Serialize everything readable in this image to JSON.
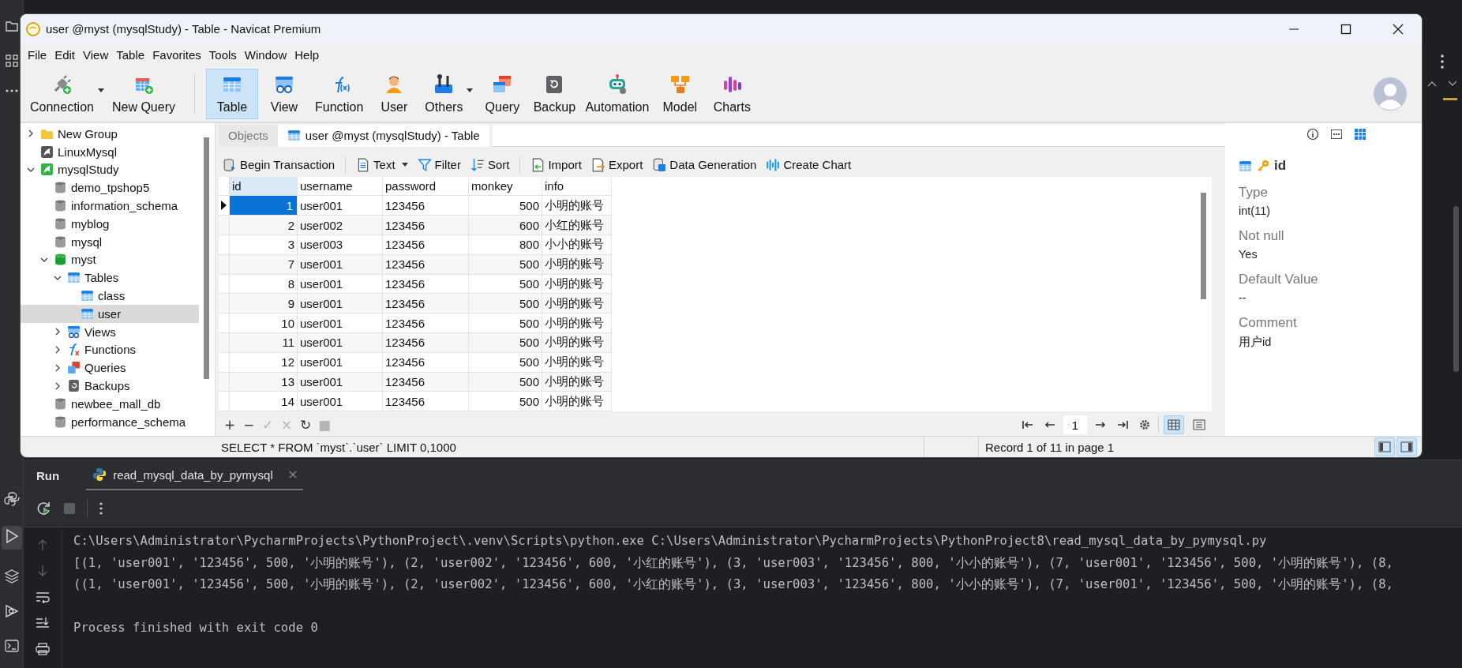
{
  "window": {
    "title": "user @myst (mysqlStudy) - Table - Navicat Premium",
    "menu": [
      "File",
      "Edit",
      "View",
      "Table",
      "Favorites",
      "Tools",
      "Window",
      "Help"
    ],
    "toolbar": [
      {
        "label": "Connection",
        "dropdown": true,
        "selected": false
      },
      {
        "label": "New Query",
        "dropdown": false,
        "selected": false
      },
      {
        "label": "Table",
        "dropdown": false,
        "selected": true
      },
      {
        "label": "View",
        "dropdown": false,
        "selected": false
      },
      {
        "label": "Function",
        "dropdown": false,
        "selected": false
      },
      {
        "label": "User",
        "dropdown": false,
        "selected": false
      },
      {
        "label": "Others",
        "dropdown": true,
        "selected": false
      },
      {
        "label": "Query",
        "dropdown": false,
        "selected": false
      },
      {
        "label": "Backup",
        "dropdown": false,
        "selected": false
      },
      {
        "label": "Automation",
        "dropdown": false,
        "selected": false
      },
      {
        "label": "Model",
        "dropdown": false,
        "selected": false
      },
      {
        "label": "Charts",
        "dropdown": false,
        "selected": false
      }
    ],
    "sidebar": {
      "items": [
        {
          "label": "New Group",
          "kind": "group",
          "expanded": false,
          "selected": false
        },
        {
          "label": "LinuxMysql",
          "kind": "connection",
          "open": false,
          "selected": false
        },
        {
          "label": "mysqlStudy",
          "kind": "connection",
          "expanded": true,
          "open": true,
          "selected": false,
          "children": [
            {
              "label": "demo_tpshop5",
              "kind": "database",
              "open": false,
              "selected": false
            },
            {
              "label": "information_schema",
              "kind": "database",
              "open": false,
              "selected": false
            },
            {
              "label": "myblog",
              "kind": "database",
              "open": false,
              "selected": false
            },
            {
              "label": "mysql",
              "kind": "database",
              "open": false,
              "selected": false
            },
            {
              "label": "myst",
              "kind": "database",
              "expanded": true,
              "open": true,
              "selected": false,
              "children": [
                {
                  "label": "Tables",
                  "kind": "tables",
                  "expanded": true,
                  "selected": false,
                  "children": [
                    {
                      "label": "class",
                      "kind": "table",
                      "selected": false
                    },
                    {
                      "label": "user",
                      "kind": "table",
                      "selected": true
                    }
                  ]
                },
                {
                  "label": "Views",
                  "kind": "views",
                  "expanded": false,
                  "selected": false
                },
                {
                  "label": "Functions",
                  "kind": "functions",
                  "expanded": false,
                  "selected": false
                },
                {
                  "label": "Queries",
                  "kind": "queries",
                  "expanded": false,
                  "selected": false
                },
                {
                  "label": "Backups",
                  "kind": "backups",
                  "expanded": false,
                  "selected": false
                }
              ]
            },
            {
              "label": "newbee_mall_db",
              "kind": "database",
              "open": false,
              "selected": false
            },
            {
              "label": "performance_schema",
              "kind": "database",
              "open": false,
              "selected": false
            }
          ]
        }
      ]
    },
    "tabs": [
      {
        "label": "Objects",
        "selected": false
      },
      {
        "label": "user @myst (mysqlStudy) - Table",
        "selected": true
      }
    ],
    "actions": [
      {
        "label": "Begin Transaction",
        "dropdown": false
      },
      {
        "label": "Text",
        "dropdown": true
      },
      {
        "label": "Filter",
        "dropdown": false
      },
      {
        "label": "Sort",
        "dropdown": false
      },
      {
        "label": "Import",
        "dropdown": false
      },
      {
        "label": "Export",
        "dropdown": false
      },
      {
        "label": "Data Generation",
        "dropdown": false
      },
      {
        "label": "Create Chart",
        "dropdown": false
      }
    ],
    "grid": {
      "columns": [
        {
          "label": "id",
          "selected": true
        },
        {
          "label": "username",
          "selected": false
        },
        {
          "label": "password",
          "selected": false
        },
        {
          "label": "monkey",
          "selected": false
        },
        {
          "label": "info",
          "selected": false
        }
      ],
      "rows": [
        {
          "cells": [
            "1",
            "user001",
            "123456",
            "500",
            "小明的账号"
          ],
          "selected": true
        },
        {
          "cells": [
            "2",
            "user002",
            "123456",
            "600",
            "小红的账号"
          ],
          "selected": false
        },
        {
          "cells": [
            "3",
            "user003",
            "123456",
            "800",
            "小小的账号"
          ],
          "selected": false
        },
        {
          "cells": [
            "7",
            "user001",
            "123456",
            "500",
            "小明的账号"
          ],
          "selected": false
        },
        {
          "cells": [
            "8",
            "user001",
            "123456",
            "500",
            "小明的账号"
          ],
          "selected": false
        },
        {
          "cells": [
            "9",
            "user001",
            "123456",
            "500",
            "小明的账号"
          ],
          "selected": false
        },
        {
          "cells": [
            "10",
            "user001",
            "123456",
            "500",
            "小明的账号"
          ],
          "selected": false
        },
        {
          "cells": [
            "11",
            "user001",
            "123456",
            "500",
            "小明的账号"
          ],
          "selected": false
        },
        {
          "cells": [
            "12",
            "user001",
            "123456",
            "500",
            "小明的账号"
          ],
          "selected": false
        },
        {
          "cells": [
            "13",
            "user001",
            "123456",
            "500",
            "小明的账号"
          ],
          "selected": false
        },
        {
          "cells": [
            "14",
            "user001",
            "123456",
            "500",
            "小明的账号"
          ],
          "selected": false
        }
      ]
    },
    "edit_actions": [
      {
        "label": "+",
        "disabled": false
      },
      {
        "label": "−",
        "disabled": false
      },
      {
        "label": "✓",
        "disabled": true
      },
      {
        "label": "×",
        "disabled": true
      },
      {
        "label": "↻",
        "disabled": false
      },
      {
        "label": "■",
        "disabled": true
      }
    ],
    "pager": {
      "page": "1",
      "views": [
        {
          "selected": true
        },
        {
          "selected": false
        }
      ]
    },
    "status_bar": {
      "sql": "SELECT * FROM `myst`.`user` LIMIT 0,1000",
      "record": "Record 1 of 11 in page 1",
      "panels": [
        {
          "selected": true
        },
        {
          "selected": true
        }
      ]
    },
    "info_panel": {
      "tabs": [
        {
          "selected": false
        },
        {
          "selected": false
        },
        {
          "selected": true
        }
      ],
      "field": {
        "name": "id",
        "primary_key": true
      },
      "properties": [
        {
          "label": "Type",
          "value": "int(11)"
        },
        {
          "label": "Not null",
          "value": "Yes"
        },
        {
          "label": "Default Value",
          "value": "--"
        },
        {
          "label": "Comment",
          "value": "用户id"
        }
      ]
    }
  },
  "run_panel": {
    "title": "Run",
    "tabs": [
      {
        "label": "read_mysql_data_by_pymysql",
        "selected": true
      }
    ],
    "lines": [
      "C:\\Users\\Administrator\\PycharmProjects\\PythonProject\\.venv\\Scripts\\python.exe C:\\Users\\Administrator\\PycharmProjects\\PythonProject8\\read_mysql_data_by_pymysql.py",
      "[(1, 'user001', '123456', 500, '小明的账号'), (2, 'user002', '123456', 600, '小红的账号'), (3, 'user003', '123456', 800, '小小的账号'), (7, 'user001', '123456', 500, '小明的账号'), (8,",
      "((1, 'user001', '123456', 500, '小明的账号'), (2, 'user002', '123456', 600, '小红的账号'), (3, 'user003', '123456', 800, '小小的账号'), (7, 'user001', '123456', 500, '小明的账号'), (8,"
    ],
    "exit_message": "Process finished with exit code 0"
  }
}
